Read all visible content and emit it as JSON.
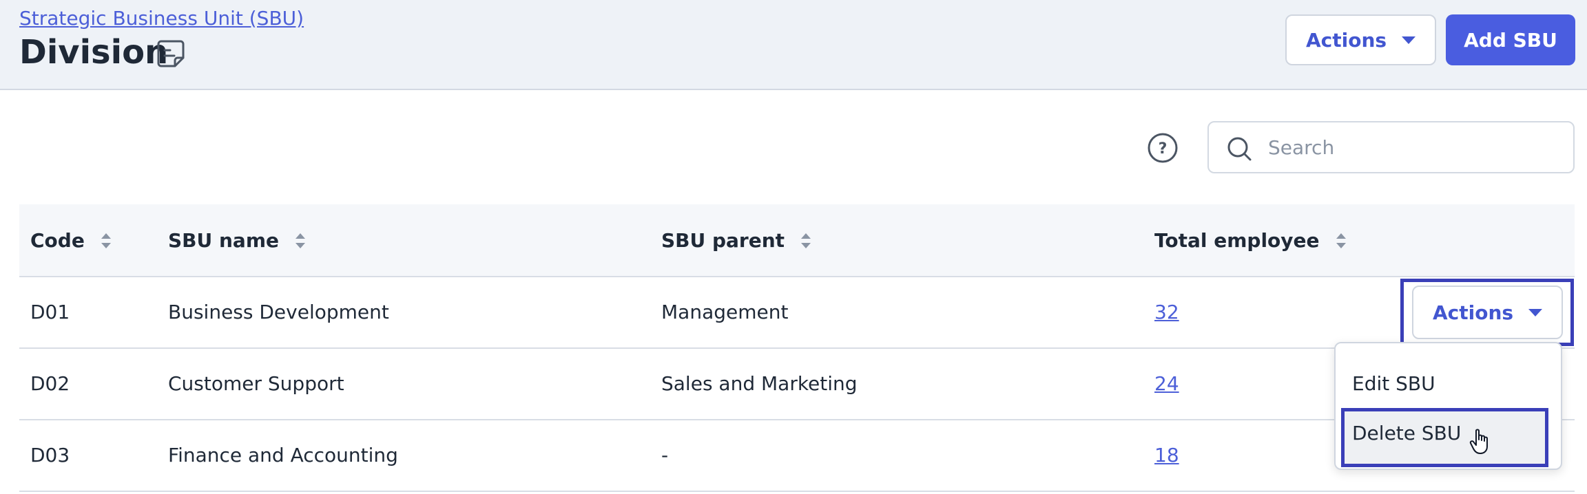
{
  "header": {
    "breadcrumb": "Strategic Business Unit (SBU)",
    "title": "Division",
    "title_icon": "note-icon",
    "actions_label": "Actions",
    "add_label": "Add SBU"
  },
  "toolbar": {
    "help_icon": "help-circle-icon",
    "search_placeholder": "Search",
    "search_value": ""
  },
  "table": {
    "columns": [
      "Code",
      "SBU name",
      "SBU parent",
      "Total employee"
    ],
    "rows": [
      {
        "code": "D01",
        "name": "Business Development",
        "parent": "Management",
        "total": "32"
      },
      {
        "code": "D02",
        "name": "Customer Support",
        "parent": "Sales and Marketing",
        "total": "24"
      },
      {
        "code": "D03",
        "name": "Finance and Accounting",
        "parent": "-",
        "total": "18"
      }
    ],
    "row_actions_label": "Actions"
  },
  "row_menu": {
    "items": [
      "Edit SBU",
      "Delete SBU"
    ],
    "hovered": "Delete SBU"
  },
  "colors": {
    "accent": "#4a5de0",
    "link": "#4c5fd8",
    "highlight": "#3a3fb8",
    "header_bg": "#eef2f7"
  }
}
